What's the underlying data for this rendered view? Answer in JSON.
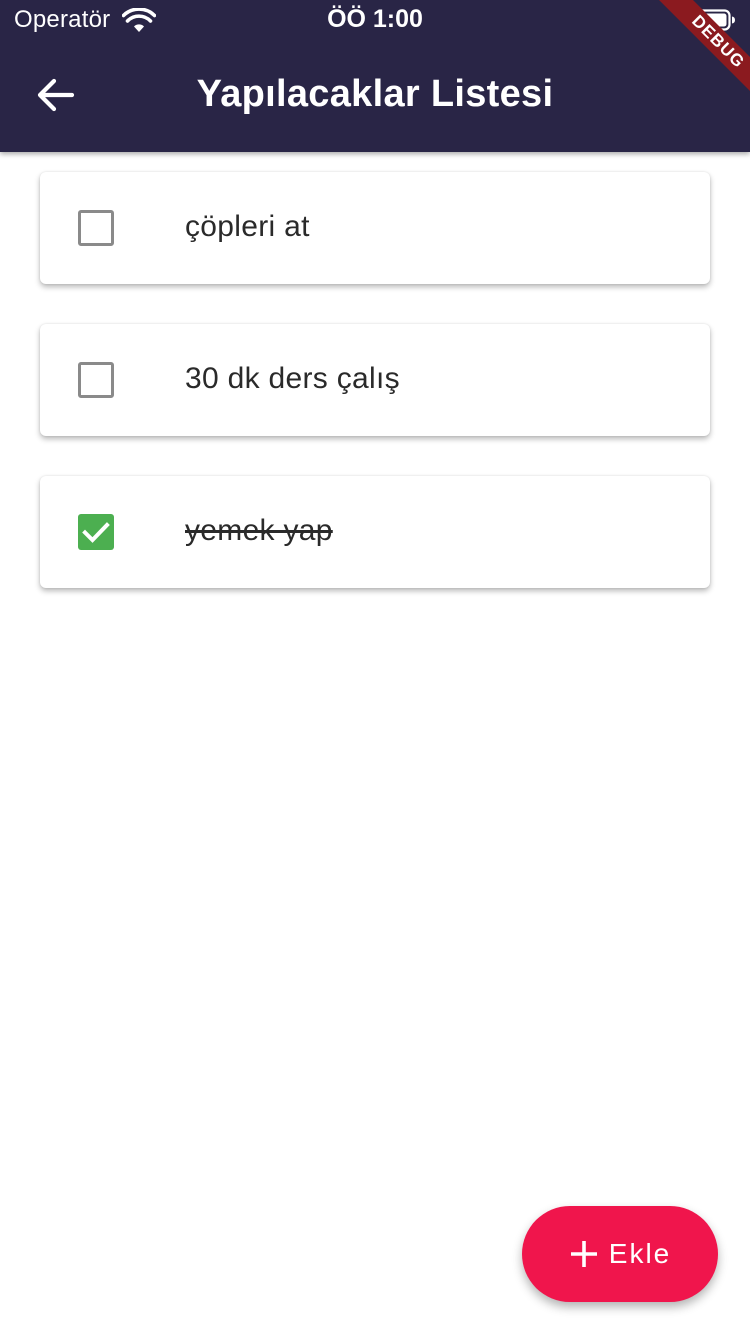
{
  "status_bar": {
    "carrier": "Operatör",
    "time": "ÖÖ 1:00",
    "wifi_icon": "wifi-icon",
    "battery_icon": "battery-icon"
  },
  "app_bar": {
    "title": "Yapılacaklar Listesi",
    "back_icon": "arrow-left-icon",
    "background_color": "#292546"
  },
  "debug_banner": "DEBUG",
  "todos": [
    {
      "text": "çöpleri at",
      "checked": false
    },
    {
      "text": "30 dk ders çalış",
      "checked": false
    },
    {
      "text": "yemek yap",
      "checked": true
    }
  ],
  "fab": {
    "label": "Ekle",
    "icon": "plus-icon",
    "color": "#f0154c"
  },
  "colors": {
    "checkbox_checked": "#4caf50",
    "checkbox_border": "#8a8a8a"
  }
}
